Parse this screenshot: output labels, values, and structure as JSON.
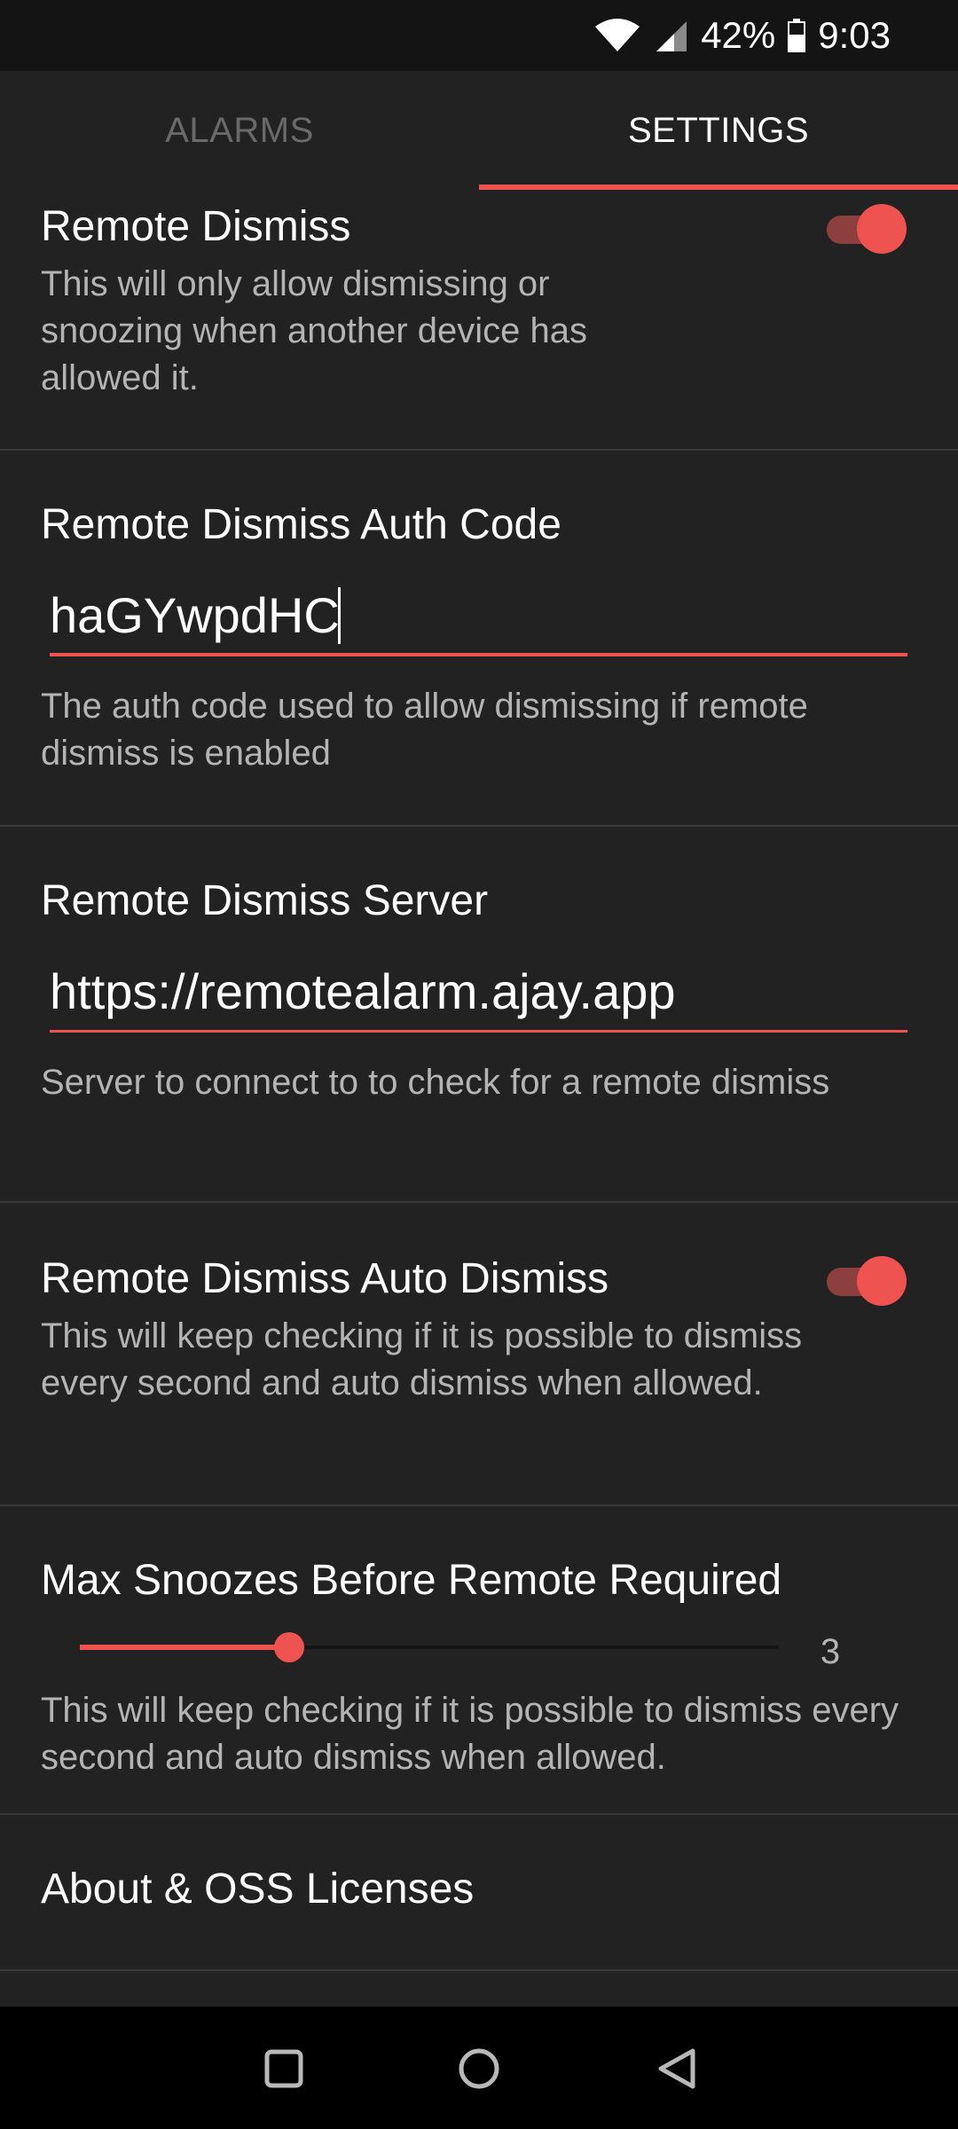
{
  "status_bar": {
    "battery": "42%",
    "time": "9:03"
  },
  "tabs": [
    {
      "label": "ALARMS",
      "active": false
    },
    {
      "label": "SETTINGS",
      "active": true
    }
  ],
  "settings": {
    "remote_dismiss": {
      "title": "Remote Dismiss",
      "summary": "This will only allow dismissing or snoozing when another device has allowed it.",
      "enabled": true
    },
    "auth_code": {
      "title": "Remote Dismiss Auth Code",
      "value": "haGYwpdHC",
      "summary": "The auth code used to allow dismissing if remote dismiss is enabled"
    },
    "server": {
      "title": "Remote Dismiss Server",
      "value": "https://remotealarm.ajay.app",
      "summary": "Server to connect to to check for a remote dismiss"
    },
    "auto_dismiss": {
      "title": "Remote Dismiss Auto Dismiss",
      "summary": "This will keep checking if it is possible to dismiss every second and auto dismiss when allowed.",
      "enabled": true
    },
    "max_snoozes": {
      "title": "Max Snoozes Before Remote Required",
      "value": "3",
      "fraction": 0.3,
      "summary": "This will keep checking if it is possible to dismiss every second and auto dismiss when allowed."
    },
    "about": {
      "title": "About & OSS Licenses"
    }
  },
  "colors": {
    "accent": "#ef5350",
    "background": "#222222"
  },
  "icons": {
    "wifi": "wifi-icon",
    "signal": "signal-icon",
    "battery": "battery-icon",
    "recents": "square-icon",
    "home": "circle-icon",
    "back": "triangle-back-icon"
  }
}
